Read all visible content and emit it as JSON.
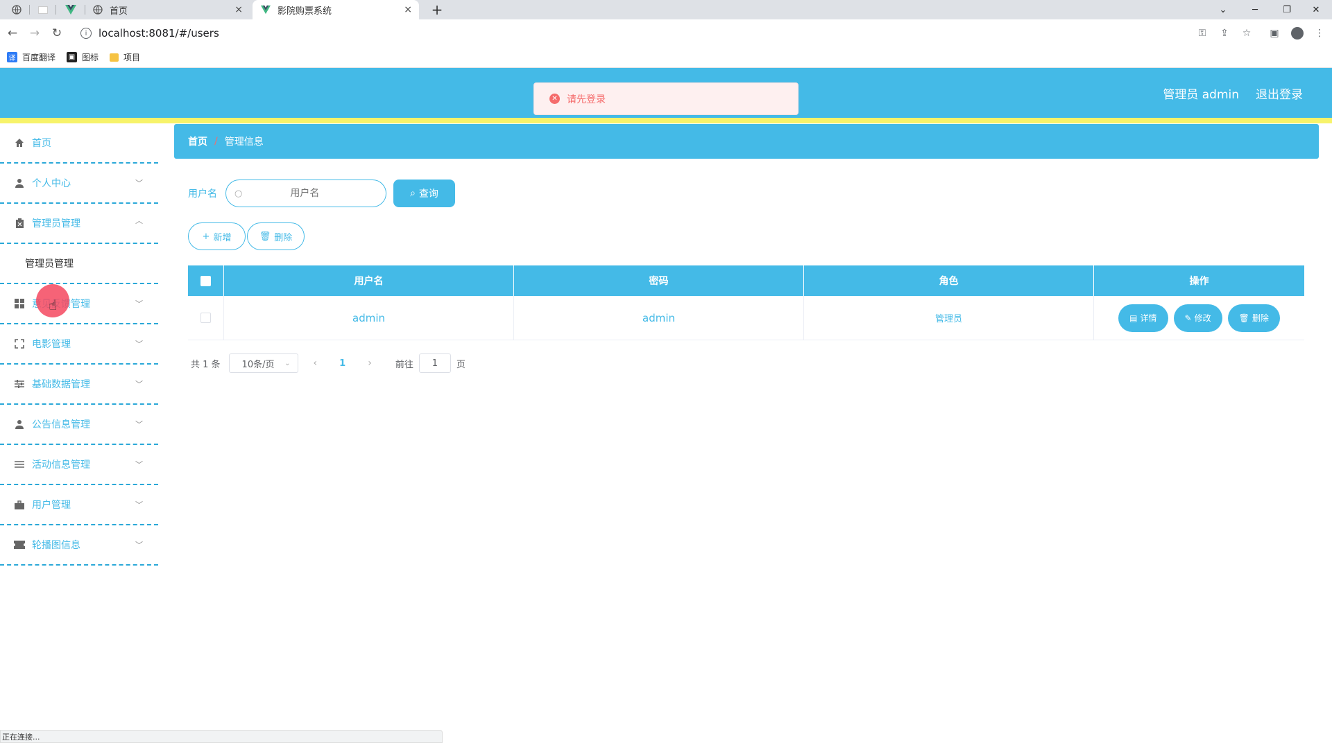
{
  "browser": {
    "tabs": [
      {
        "title": "首页",
        "close": "×"
      },
      {
        "title": "影院购票系统",
        "close": "×"
      }
    ],
    "new_tab": "+",
    "url": "localhost:8081/#/users",
    "bookmarks": [
      "百度翻译",
      "图标",
      "项目"
    ],
    "status_text": "正在连接..."
  },
  "header": {
    "user_label": "管理员 admin",
    "logout_label": "退出登录",
    "toast_message": "请先登录"
  },
  "sidebar": {
    "items": [
      {
        "label": "首页",
        "icon": "home-icon"
      },
      {
        "label": "个人中心",
        "icon": "user-icon"
      },
      {
        "label": "管理员管理",
        "icon": "clipboard-icon"
      },
      {
        "label": "管理员管理",
        "icon": ""
      },
      {
        "label": "意见反馈管理",
        "icon": "grid-icon"
      },
      {
        "label": "电影管理",
        "icon": "fullscreen-icon"
      },
      {
        "label": "基础数据管理",
        "icon": "sliders-icon"
      },
      {
        "label": "公告信息管理",
        "icon": "user-icon"
      },
      {
        "label": "活动信息管理",
        "icon": "list-icon"
      },
      {
        "label": "用户管理",
        "icon": "briefcase-icon"
      },
      {
        "label": "轮播图信息",
        "icon": "ticket-icon"
      }
    ]
  },
  "breadcrumb": {
    "home": "首页",
    "separator": "/",
    "current": "管理信息"
  },
  "search": {
    "label": "用户名",
    "placeholder": "用户名",
    "query_label": "查询"
  },
  "actions": {
    "add_label": "新增",
    "delete_label": "删除"
  },
  "table": {
    "columns": [
      "用户名",
      "密码",
      "角色",
      "操作"
    ],
    "rows": [
      {
        "username": "admin",
        "password": "admin",
        "role": "管理员"
      }
    ],
    "row_actions": {
      "detail": "详情",
      "edit": "修改",
      "delete": "删除"
    }
  },
  "pagination": {
    "total_text": "共 1 条",
    "page_size": "10条/页",
    "current_page": "1",
    "goto_prefix": "前往",
    "goto_value": "1",
    "goto_suffix": "页"
  },
  "colors": {
    "primary": "#44bae7",
    "stripe": "#f7f36a",
    "danger": "#f56c6c"
  }
}
